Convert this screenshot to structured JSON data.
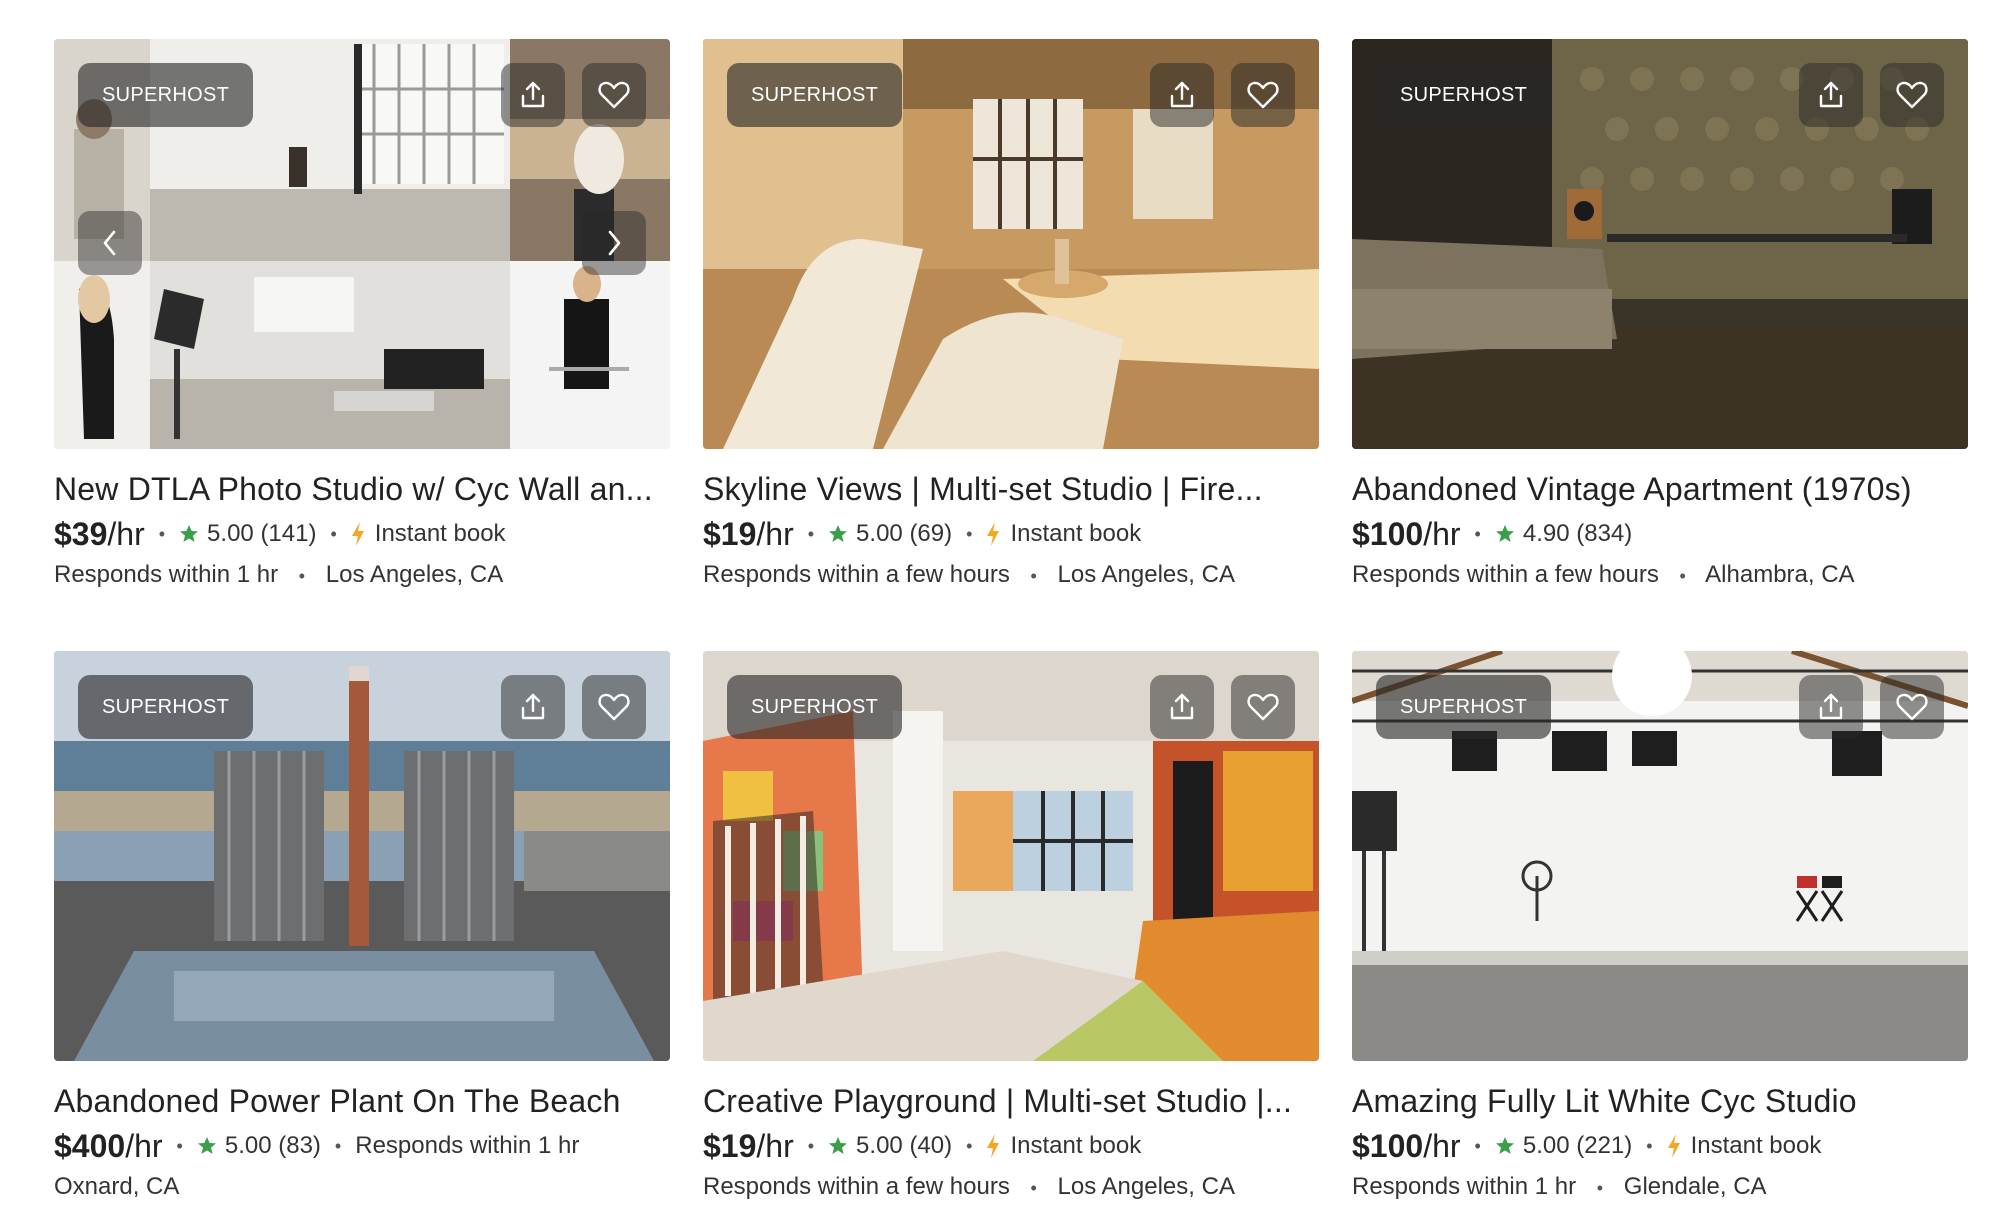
{
  "listings": [
    {
      "badge": "SUPERHOST",
      "title": "New DTLA Photo Studio w/ Cyc Wall an...",
      "price": "$39",
      "per": "/hr",
      "rating": "5.00",
      "reviews": "(141)",
      "tag": "Instant book",
      "responds": "Responds within 1 hr",
      "location": "Los Angeles, CA"
    },
    {
      "badge": "SUPERHOST",
      "title": "Skyline Views | Multi-set Studio | Fire...",
      "price": "$19",
      "per": "/hr",
      "rating": "5.00",
      "reviews": "(69)",
      "tag": "Instant book",
      "responds": "Responds within a few hours",
      "location": "Los Angeles, CA"
    },
    {
      "badge": "SUPERHOST",
      "title": "Abandoned Vintage Apartment (1970s)",
      "price": "$100",
      "per": "/hr",
      "rating": "4.90",
      "reviews": "(834)",
      "responds": "Responds within a few hours",
      "location": "Alhambra, CA"
    },
    {
      "badge": "SUPERHOST",
      "title": "Abandoned Power Plant On The Beach",
      "price": "$400",
      "per": "/hr",
      "rating": "5.00",
      "reviews": "(83)",
      "tag": "Responds within 1 hr",
      "location": "Oxnard, CA"
    },
    {
      "badge": "SUPERHOST",
      "title": "Creative Playground | Multi-set Studio |...",
      "price": "$19",
      "per": "/hr",
      "rating": "5.00",
      "reviews": "(40)",
      "tag": "Instant book",
      "responds": "Responds within a few hours",
      "location": "Los Angeles, CA"
    },
    {
      "badge": "SUPERHOST",
      "title": "Amazing Fully Lit White Cyc Studio",
      "price": "$100",
      "per": "/hr",
      "rating": "5.00",
      "reviews": "(221)",
      "tag": "Instant book",
      "responds": "Responds within 1 hr",
      "location": "Glendale, CA"
    }
  ],
  "icons": {
    "share": "share-icon",
    "favorite": "heart-icon",
    "star": "star-icon",
    "instant": "lightning-bolt-icon",
    "prev": "chevron-left-icon",
    "next": "chevron-right-icon"
  },
  "colors": {
    "star": "#3b9f4a",
    "instant_bolt": "#f5a623",
    "badge_bg": "#282828"
  }
}
